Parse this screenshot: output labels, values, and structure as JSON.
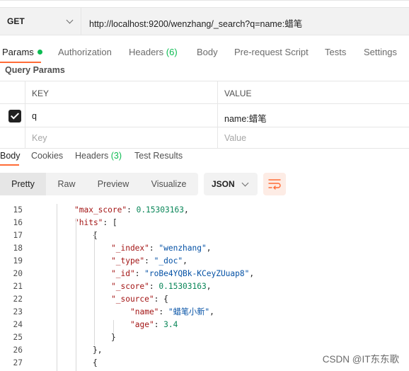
{
  "request": {
    "method": "GET",
    "url": "http://localhost:9200/wenzhang/_search?q=name:蜡笔"
  },
  "request_tabs": {
    "params": "Params",
    "authorization": "Authorization",
    "headers": "Headers",
    "headers_count": "(6)",
    "body": "Body",
    "prerequest": "Pre-request Script",
    "tests": "Tests",
    "settings": "Settings"
  },
  "query_params": {
    "title": "Query Params",
    "col_key": "KEY",
    "col_value": "VALUE",
    "rows": [
      {
        "key": "q",
        "value": "name:蜡笔",
        "checked": true
      }
    ],
    "placeholder_key": "Key",
    "placeholder_value": "Value"
  },
  "response_tabs": {
    "body": "Body",
    "cookies": "Cookies",
    "headers": "Headers",
    "headers_count": "(3)",
    "test_results": "Test Results"
  },
  "response_toolbar": {
    "pretty": "Pretty",
    "raw": "Raw",
    "preview": "Preview",
    "visualize": "Visualize",
    "format": "JSON"
  },
  "code_lines": [
    {
      "num": "15",
      "key": "\"max_score\"",
      "sep": ": ",
      "val": "0.15303163",
      "vtype": "n",
      "tail": ","
    },
    {
      "num": "16",
      "key": "\"hits\"",
      "sep": ": ",
      "val": "",
      "vtype": "p",
      "tail": "["
    },
    {
      "num": "17",
      "key": "",
      "sep": "",
      "val": "",
      "vtype": "p",
      "tail": "{"
    },
    {
      "num": "18",
      "key": "\"_index\"",
      "sep": ": ",
      "val": "\"wenzhang\"",
      "vtype": "s",
      "tail": ","
    },
    {
      "num": "19",
      "key": "\"_type\"",
      "sep": ": ",
      "val": "\"_doc\"",
      "vtype": "s",
      "tail": ","
    },
    {
      "num": "20",
      "key": "\"_id\"",
      "sep": ": ",
      "val": "\"roBe4YQBk-KCeyZUuap8\"",
      "vtype": "s",
      "tail": ","
    },
    {
      "num": "21",
      "key": "\"_score\"",
      "sep": ": ",
      "val": "0.15303163",
      "vtype": "n",
      "tail": ","
    },
    {
      "num": "22",
      "key": "\"_source\"",
      "sep": ": ",
      "val": "",
      "vtype": "p",
      "tail": "{"
    },
    {
      "num": "23",
      "key": "\"name\"",
      "sep": ": ",
      "val": "\"蜡笔小新\"",
      "vtype": "s",
      "tail": ","
    },
    {
      "num": "24",
      "key": "\"age\"",
      "sep": ": ",
      "val": "3.4",
      "vtype": "n",
      "tail": ""
    },
    {
      "num": "25",
      "key": "",
      "sep": "",
      "val": "",
      "vtype": "p",
      "tail": "}"
    },
    {
      "num": "26",
      "key": "",
      "sep": "",
      "val": "",
      "vtype": "p",
      "tail": "},"
    },
    {
      "num": "27",
      "key": "",
      "sep": "",
      "val": "",
      "vtype": "p",
      "tail": "{"
    }
  ],
  "watermark": "CSDN @IT东东歌",
  "colors": {
    "accent": "#ff6c37",
    "success": "#0cbb52",
    "json_key": "#a31515",
    "json_string": "#0451a5",
    "json_number": "#098658"
  },
  "icons": {
    "method_dropdown": "chevron-down-icon",
    "format_dropdown": "chevron-down-icon",
    "wrap": "wrap-lines-icon",
    "checkbox": "checkbox-checked-icon"
  }
}
